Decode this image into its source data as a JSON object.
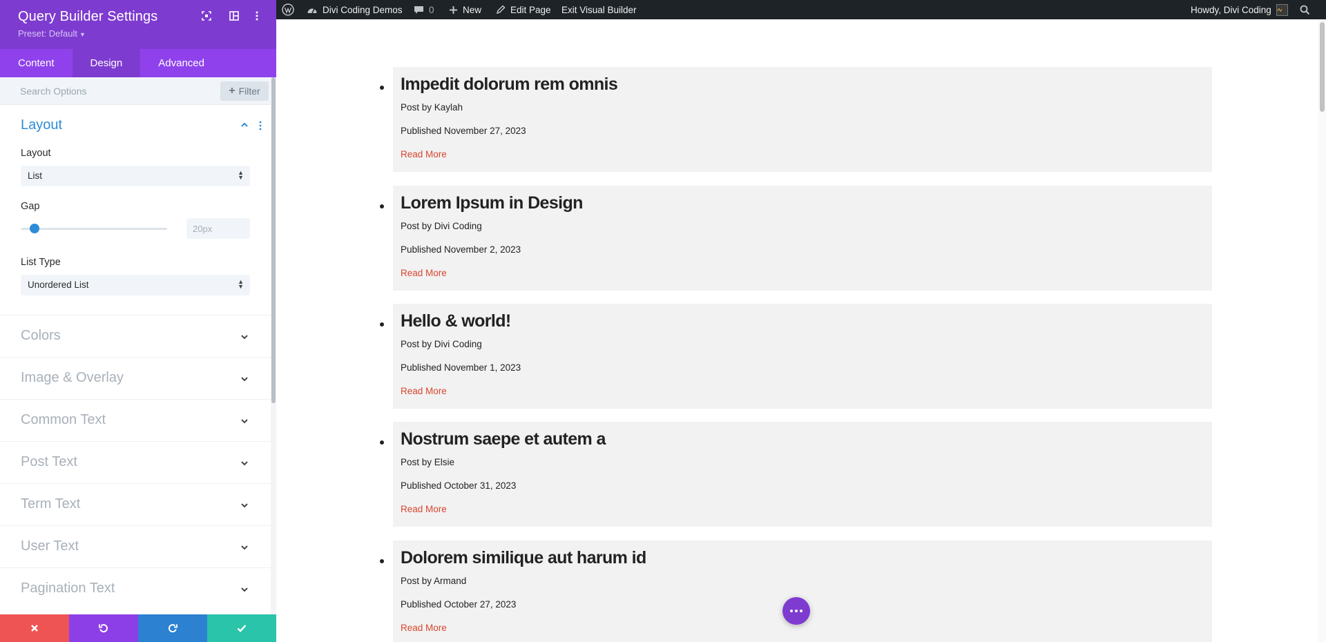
{
  "panel": {
    "title": "Query Builder Settings",
    "preset": "Preset: Default",
    "tabs": [
      {
        "label": "Content",
        "active": false
      },
      {
        "label": "Design",
        "active": true
      },
      {
        "label": "Advanced",
        "active": false
      }
    ],
    "search_placeholder": "Search Options",
    "filter_label": "Filter",
    "layout_group": {
      "title": "Layout",
      "layout_label": "Layout",
      "layout_value": "List",
      "gap_label": "Gap",
      "gap_value": "20px",
      "gap_slider_fraction": 0.06,
      "list_type_label": "List Type",
      "list_type_value": "Unordered List"
    },
    "groups": [
      "Colors",
      "Image & Overlay",
      "Common Text",
      "Post Text",
      "Term Text",
      "User Text",
      "Pagination Text"
    ],
    "bottom_bar": {
      "cancel_color": "#ef5454",
      "undo_color": "#8c3fe6",
      "redo_color": "#2c81d1",
      "save_color": "#29c4a9"
    }
  },
  "admin_bar": {
    "site_name": "Divi Coding Demos",
    "comments_count": "0",
    "new_label": "New",
    "edit_page_label": "Edit Page",
    "exit_builder_label": "Exit Visual Builder",
    "howdy": "Howdy, Divi Coding"
  },
  "posts": [
    {
      "title": "Impedit dolorum rem omnis",
      "author": "Post by Kaylah",
      "date": "Published November 27, 2023",
      "more": "Read More"
    },
    {
      "title": "Lorem Ipsum in Design",
      "author": "Post by Divi Coding",
      "date": "Published November 2, 2023",
      "more": "Read More"
    },
    {
      "title": "Hello & world!",
      "author": "Post by Divi Coding",
      "date": "Published November 1, 2023",
      "more": "Read More"
    },
    {
      "title": "Nostrum saepe et autem a",
      "author": "Post by Elsie",
      "date": "Published October 31, 2023",
      "more": "Read More"
    },
    {
      "title": "Dolorem similique aut harum id",
      "author": "Post by Armand",
      "date": "Published October 27, 2023",
      "more": "Read More"
    }
  ],
  "colors": {
    "brand_purple": "#7e3bd0",
    "tab_purple": "#8f42ec",
    "accent_blue": "#2e8bd8",
    "read_more_red": "#d8452d",
    "admin_bar_bg": "#1d2327"
  }
}
